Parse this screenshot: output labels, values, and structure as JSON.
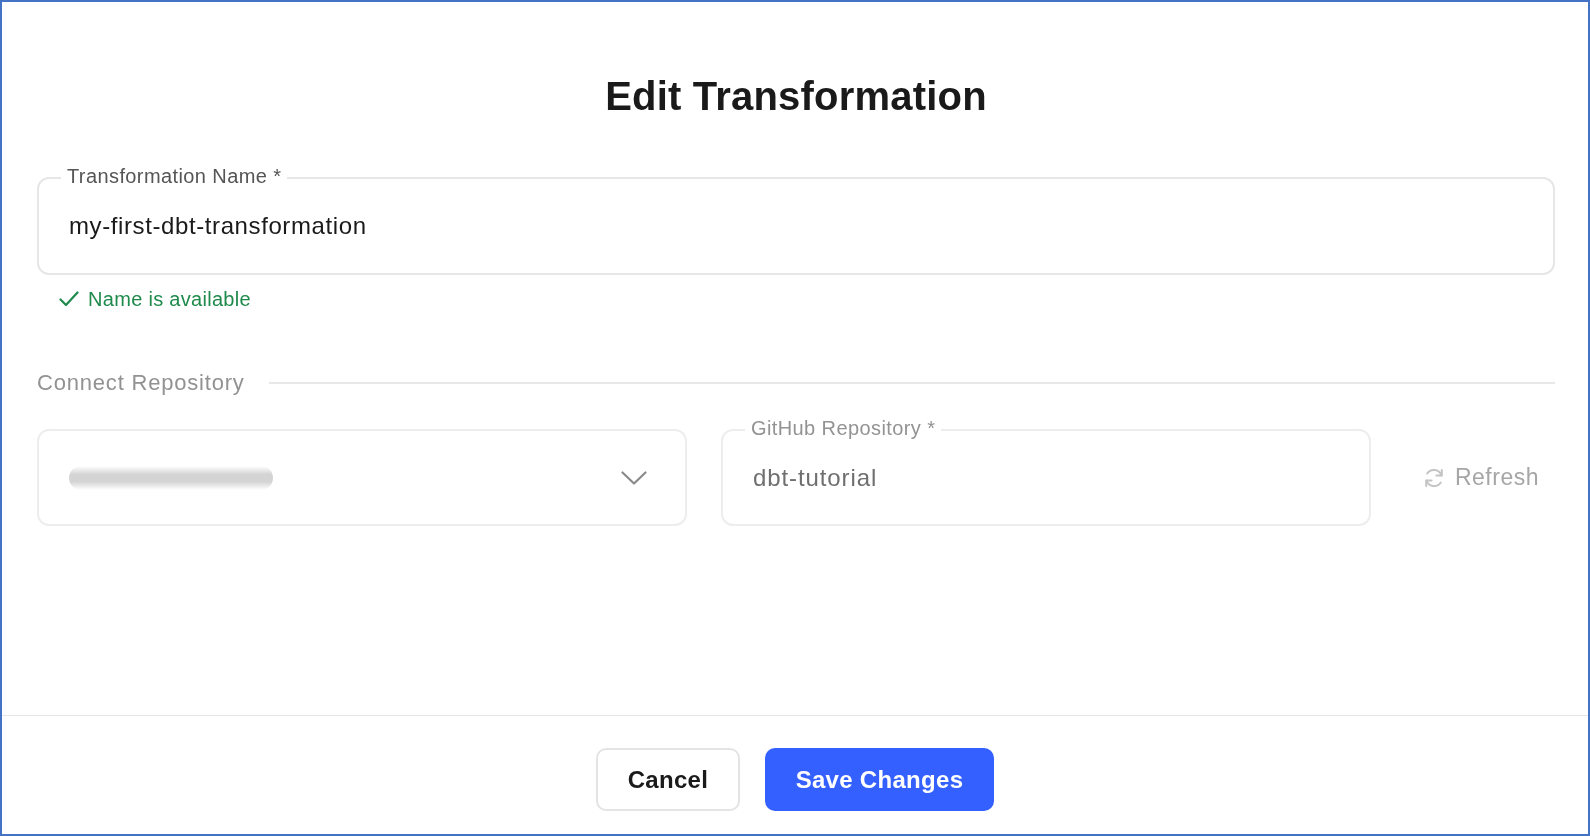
{
  "dialog": {
    "title": "Edit Transformation"
  },
  "name_field": {
    "label": "Transformation Name *",
    "value": "my-first-dbt-transformation",
    "validation": {
      "valid": true,
      "message": "Name is available"
    }
  },
  "repository_section": {
    "heading": "Connect Repository",
    "disabled": true,
    "account_select": {
      "placeholder_blurred": true
    },
    "repository_field": {
      "label": "GitHub Repository *",
      "value": "dbt-tutorial"
    },
    "refresh_button": {
      "label": "Refresh",
      "disabled": true
    }
  },
  "buttons": [
    {
      "label": "Cancel",
      "kind": "secondary"
    },
    {
      "label": "Save Changes",
      "kind": "primary"
    }
  ]
}
